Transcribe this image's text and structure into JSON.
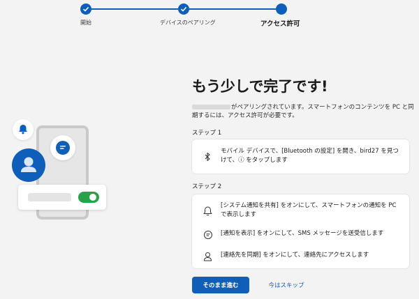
{
  "stepper": {
    "steps": [
      {
        "label": "開始",
        "state": "done"
      },
      {
        "label": "デバイスのペアリング",
        "state": "done"
      },
      {
        "label": "アクセス許可",
        "state": "current"
      }
    ]
  },
  "main": {
    "title": "もう少しで完了です!",
    "description": "がペアリングされています。スマートフォンのコンテンツを PC と同期するには、アクセス許可が必要です。",
    "step1": {
      "label": "ステップ 1",
      "items": [
        {
          "icon": "bluetooth-icon",
          "text": "モバイル デバイスで、[Bluetooth の設定] を開き、bird27 を見つけて、ⓘ をタップします"
        }
      ]
    },
    "step2": {
      "label": "ステップ 2",
      "items": [
        {
          "icon": "bell-icon",
          "text": "[システム通知を共有] をオンにして、スマートフォンの通知を PC で表示します"
        },
        {
          "icon": "message-icon",
          "text": "[通知を表示] をオンにして、SMS メッセージを送受信します"
        },
        {
          "icon": "person-icon",
          "text": "[連絡先を同期] をオンにして、連絡先にアクセスします"
        }
      ]
    }
  },
  "actions": {
    "continue_label": "そのまま進む",
    "skip_label": "今はスキップ"
  },
  "colors": {
    "accent": "#0f5fb8",
    "toggle_on": "#27a249",
    "background": "#f3f3f3"
  }
}
